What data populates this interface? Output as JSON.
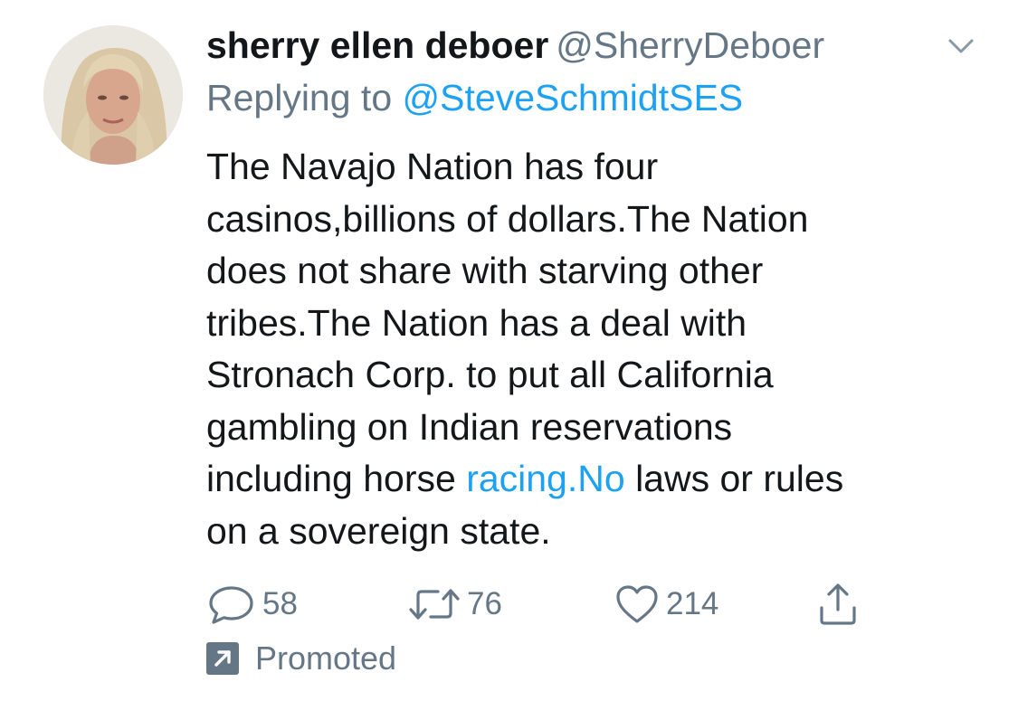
{
  "tweet": {
    "display_name": "sherry ellen deboer",
    "handle": "@SherryDeboer",
    "replying_prefix": "Replying to",
    "replying_handle": "@SteveSchmidtSES",
    "text_lines": [
      "The Navajo Nation has four",
      "casinos,billions of dollars.The Nation",
      "does not share with starving other",
      "tribes.The Nation has a deal with",
      "Stronach Corp. to put all California",
      "gambling on Indian reservations"
    ],
    "last_lines": {
      "line7_before": "including horse ",
      "line7_link": "racing.No",
      "line7_after": " laws or rules",
      "line8": "on a sovereign state."
    },
    "actions": {
      "reply_count": "58",
      "retweet_count": "76",
      "like_count": "214"
    },
    "promoted_label": "Promoted"
  },
  "colors": {
    "text": "#14171a",
    "secondary": "#657786",
    "link": "#1da1f2"
  },
  "icons": {
    "reply": "speech-bubble-icon",
    "retweet": "retweet-arrows-icon",
    "like": "heart-icon",
    "share": "share-upload-icon",
    "caret": "chevron-down-icon",
    "promoted": "promoted-arrow-icon"
  }
}
